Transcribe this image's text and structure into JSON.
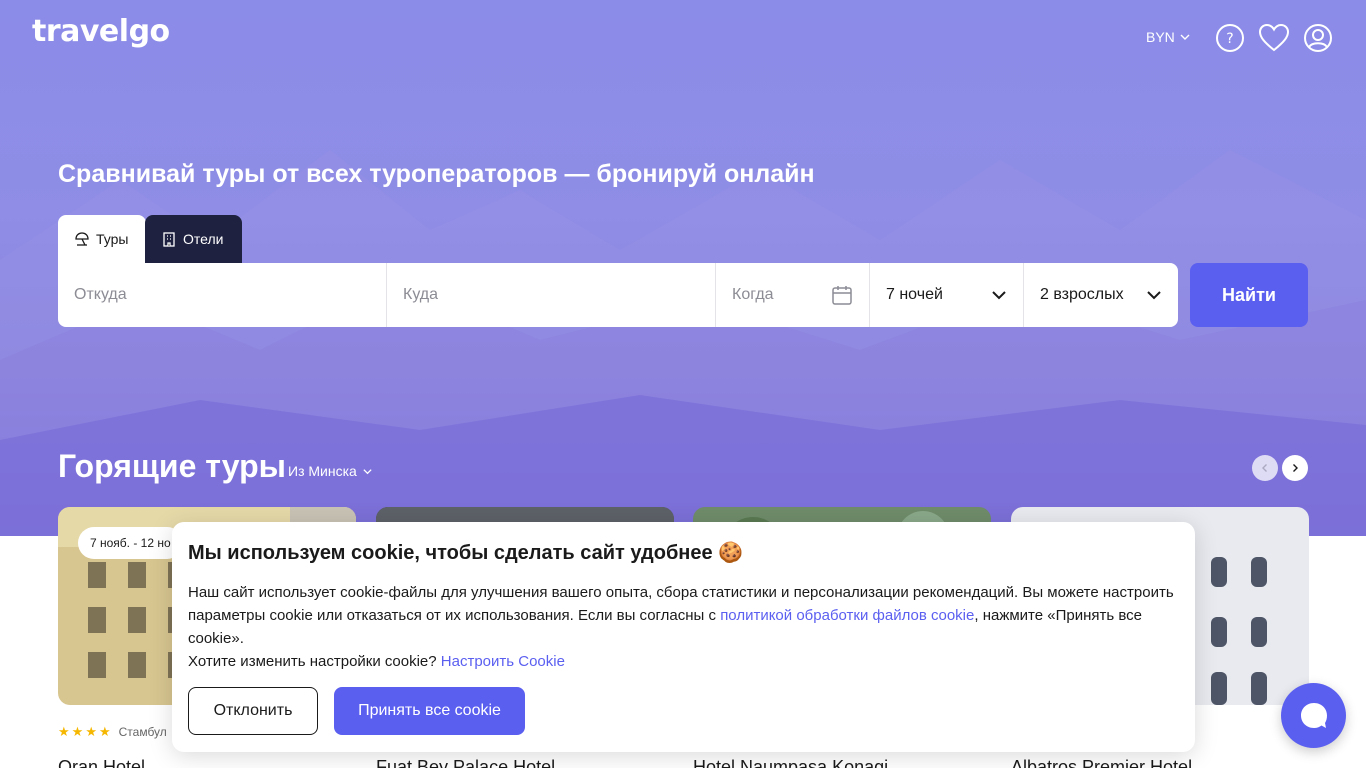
{
  "header": {
    "logo": "travelgo",
    "currency": "BYN",
    "icons": [
      "chevron-down-icon",
      "help-icon",
      "heart-icon",
      "user-icon"
    ]
  },
  "hero": {
    "headline": "Сравнивай туры от всех туроператоров — бронируй онлайн"
  },
  "tabs": [
    {
      "label": "Туры",
      "icon": "umbrella-icon",
      "active": true
    },
    {
      "label": "Отели",
      "icon": "building-icon",
      "active": false
    }
  ],
  "search": {
    "from_placeholder": "Откуда",
    "to_placeholder": "Куда",
    "when_placeholder": "Когда",
    "nights": "7 ночей",
    "guests": "2 взрослых",
    "find_label": "Найти"
  },
  "hot_tours": {
    "title": "Горящие туры",
    "from_city": "Из Минска",
    "cards": [
      {
        "name": "Oran Hotel",
        "date": "7 нояб. - 12 но",
        "stars": 4,
        "location": "Стамбул"
      },
      {
        "name": "Fuat Bey Palace Hotel"
      },
      {
        "name": "Hotel Naumpasa Konagi"
      },
      {
        "name": "Albatros Premier Hotel"
      }
    ]
  },
  "cookie": {
    "title": "Мы используем cookie, чтобы сделать сайт удобнее 🍪",
    "text_part1": "Наш сайт использует cookie-файлы для улучшения вашего опыта, сбора статистики и персонализации рекомендаций. Вы можете настроить параметры cookie или отказаться от их использования. Если вы согласны с ",
    "policy_link": "политикой обработки файлов cookie",
    "text_part2": ", нажмите «Принять все cookie».",
    "settings_question": "Хотите изменить настройки cookie? ",
    "settings_link": "Настроить Cookie",
    "decline_label": "Отклонить",
    "accept_label": "Принять все cookie"
  },
  "colors": {
    "accent": "#5b5ff0",
    "hero_top": "#8b8ce8",
    "dark_tab": "#1e2140"
  }
}
